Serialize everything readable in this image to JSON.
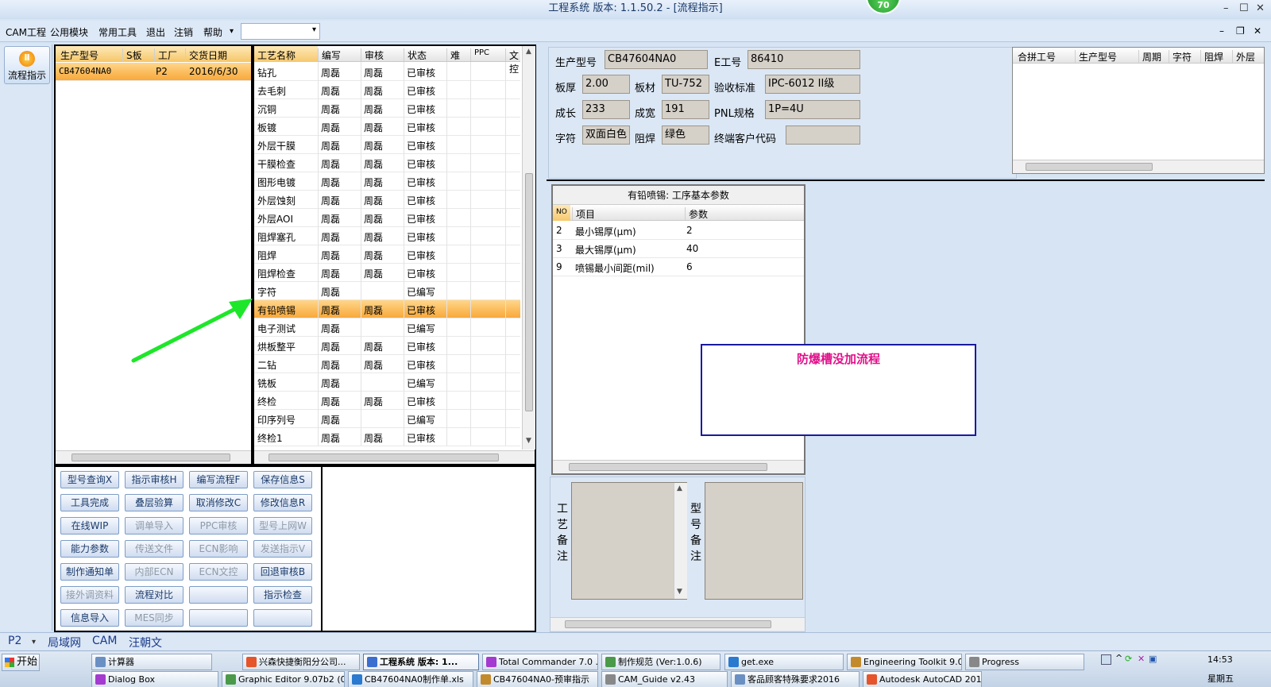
{
  "window": {
    "title": "工程系统  版本: 1.1.50.2 - [流程指示]",
    "badge": "70",
    "controls": {
      "min": "–",
      "max": "☐",
      "close": "✕",
      "mdi_min": "–",
      "mdi_max": "❐",
      "mdi_close": "✕"
    }
  },
  "menu": {
    "items": [
      "CAM工程",
      "公用模块",
      "常用工具",
      "退出",
      "注销",
      "帮助"
    ],
    "help_arrow": "▾",
    "combo_arrow": "▾"
  },
  "nav": {
    "flow_label": "流程指示"
  },
  "orders": {
    "headers": [
      "生产型号",
      "S板",
      "工厂",
      "交货日期"
    ],
    "rows": [
      [
        "CB47604NA0",
        "",
        "P2",
        "2016/6/30"
      ]
    ]
  },
  "process": {
    "headers": [
      "工艺名称",
      "编写",
      "审核",
      "状态",
      "难",
      "PPC",
      "文控"
    ],
    "rows": [
      [
        "钻孔",
        "周磊",
        "周磊",
        "已审核"
      ],
      [
        "去毛刺",
        "周磊",
        "周磊",
        "已审核"
      ],
      [
        "沉铜",
        "周磊",
        "周磊",
        "已审核"
      ],
      [
        "板镀",
        "周磊",
        "周磊",
        "已审核"
      ],
      [
        "外层干膜",
        "周磊",
        "周磊",
        "已审核"
      ],
      [
        "干膜检查",
        "周磊",
        "周磊",
        "已审核"
      ],
      [
        "图形电镀",
        "周磊",
        "周磊",
        "已审核"
      ],
      [
        "外层蚀刻",
        "周磊",
        "周磊",
        "已审核"
      ],
      [
        "外层AOI",
        "周磊",
        "周磊",
        "已审核"
      ],
      [
        "阻焊塞孔",
        "周磊",
        "周磊",
        "已审核"
      ],
      [
        "阻焊",
        "周磊",
        "周磊",
        "已审核"
      ],
      [
        "阻焊检查",
        "周磊",
        "周磊",
        "已审核"
      ],
      [
        "字符",
        "周磊",
        "",
        "已编写"
      ],
      [
        "有铅喷锡",
        "周磊",
        "周磊",
        "已审核"
      ],
      [
        "电子测试",
        "周磊",
        "",
        "已编写"
      ],
      [
        "烘板整平",
        "周磊",
        "周磊",
        "已审核"
      ],
      [
        "二钻",
        "周磊",
        "周磊",
        "已审核"
      ],
      [
        "铣板",
        "周磊",
        "",
        "已编写"
      ],
      [
        "终检",
        "周磊",
        "周磊",
        "已审核"
      ],
      [
        "印序列号",
        "周磊",
        "",
        "已编写"
      ],
      [
        "终检1",
        "周磊",
        "周磊",
        "已审核"
      ]
    ],
    "selected_index": 13
  },
  "buttons": [
    {
      "label": "型号查询X",
      "enabled": true
    },
    {
      "label": "指示审核H",
      "enabled": true
    },
    {
      "label": "编写流程F",
      "enabled": true
    },
    {
      "label": "保存信息S",
      "enabled": true
    },
    {
      "label": "工具完成",
      "enabled": true
    },
    {
      "label": "叠层验算",
      "enabled": true
    },
    {
      "label": "取消修改C",
      "enabled": true
    },
    {
      "label": "修改信息R",
      "enabled": true
    },
    {
      "label": "在线WIP",
      "enabled": true
    },
    {
      "label": "调单导入",
      "enabled": false
    },
    {
      "label": "PPC审核",
      "enabled": false
    },
    {
      "label": "型号上网W",
      "enabled": false
    },
    {
      "label": "能力参数",
      "enabled": true
    },
    {
      "label": "传送文件",
      "enabled": false
    },
    {
      "label": "ECN影响",
      "enabled": false
    },
    {
      "label": "发送指示V",
      "enabled": false
    },
    {
      "label": "制作通知单",
      "enabled": true
    },
    {
      "label": "内部ECN",
      "enabled": false
    },
    {
      "label": "ECN文控",
      "enabled": false
    },
    {
      "label": "回退审核B",
      "enabled": true
    },
    {
      "label": "接外调资料",
      "enabled": false
    },
    {
      "label": "流程对比",
      "enabled": true
    },
    {
      "label": "",
      "enabled": true
    },
    {
      "label": "指示检查",
      "enabled": true
    },
    {
      "label": "信息导入",
      "enabled": true
    },
    {
      "label": "MES同步",
      "enabled": false
    },
    {
      "label": "",
      "enabled": true
    },
    {
      "label": "",
      "enabled": true
    }
  ],
  "info": {
    "model_label": "生产型号",
    "model_value": "CB47604NA0",
    "eno_label": "E工号",
    "eno_value": "86410",
    "thick_label": "板厚",
    "thick_value": "2.00",
    "material_label": "板材",
    "material_value": "TU-752",
    "std_label": "验收标准",
    "std_value": "IPC-6012 II级",
    "len_label": "成长",
    "len_value": "233",
    "width_label": "成宽",
    "width_value": "191",
    "pnl_label": "PNL规格",
    "pnl_value": "1P=4U",
    "char_label": "字符",
    "char_value": "双面白色",
    "mask_label": "阻焊",
    "mask_value": "绿色",
    "client_label": "终端客户代码",
    "client_value": ""
  },
  "merge": {
    "headers": [
      "合拼工号",
      "生产型号",
      "周期",
      "字符",
      "阻焊",
      "外层"
    ]
  },
  "params": {
    "title": "有铅喷锡: 工序基本参数",
    "headers": [
      "NO",
      "项目",
      "参数"
    ],
    "rows": [
      [
        "2",
        "最小锡厚(μm)",
        "2"
      ],
      [
        "3",
        "最大锡厚(μm)",
        "40"
      ],
      [
        "9",
        "喷锡最小间距(mil)",
        "6"
      ]
    ]
  },
  "note": {
    "text": "防爆槽没加流程"
  },
  "remarks": {
    "process_label": [
      "工",
      "艺",
      "备",
      "注"
    ],
    "model_label": [
      "型",
      "号",
      "备",
      "注"
    ]
  },
  "status": {
    "factory": "P2",
    "network": "局域网",
    "module": "CAM",
    "user": "汪朝文",
    "arrow": "▾"
  },
  "taskbar": {
    "start": "开始",
    "row1": [
      "计算器",
      "兴森快捷衡阳分公司...",
      "工程系统  版本: 1...",
      "Total Commander 7.0 ...",
      "制作规范 (Ver:1.0.6)",
      "get.exe",
      "Engineering Toolkit 9.0...",
      "Progress"
    ],
    "row2": [
      "Dialog Box",
      "Graphic Editor 9.07b2 (0...",
      "CB47604NA0制作单.xls",
      "CB47604NA0-预审指示",
      "CAM_Guide v2.43",
      "客品顾客特殊要求2016",
      "Autodesk AutoCAD 2014"
    ],
    "clock": "14:53",
    "weekday": "星期五"
  },
  "colors": {
    "selection": "#f8a93a",
    "arrow": "#1ee62a",
    "note_title": "#e0108a",
    "note_border": "#1a1aa0"
  }
}
